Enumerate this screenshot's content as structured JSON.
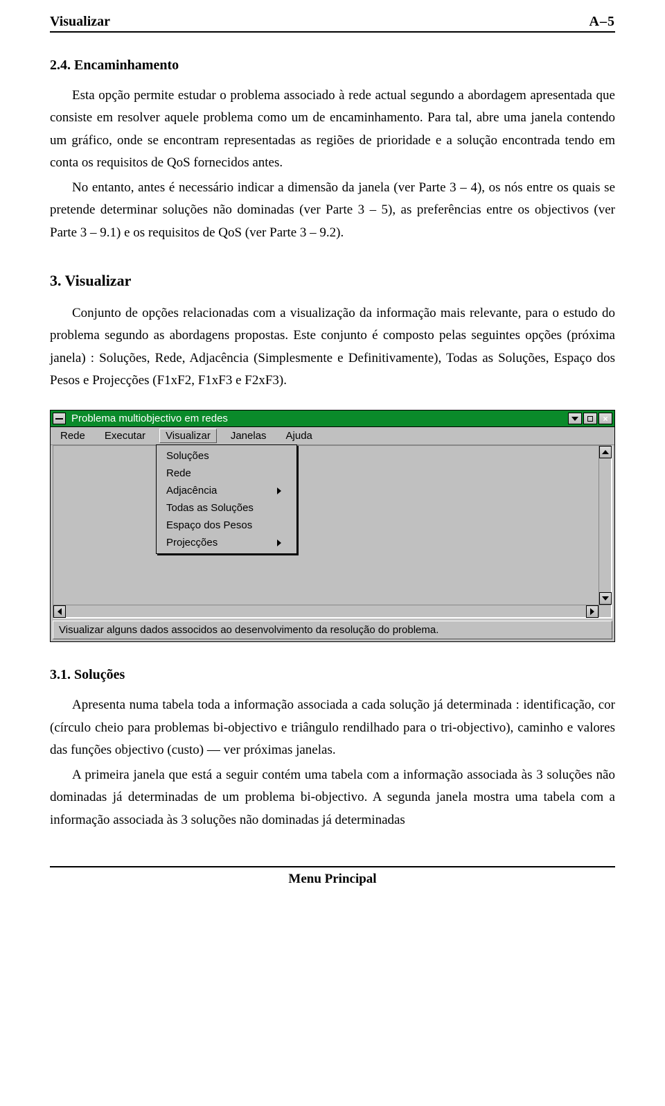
{
  "header": {
    "left": "Visualizar",
    "right": "A–5"
  },
  "sec24": {
    "heading": "2.4. Encaminhamento",
    "p1": "Esta opção permite estudar o problema associado à rede actual segundo a abordagem apresentada que consiste em resolver aquele problema como um de encaminhamento. Para tal, abre uma janela contendo um gráfico, onde se encontram representadas as regiões de prioridade e a solução encontrada tendo em conta os requisitos de QoS fornecidos antes.",
    "p2": "No entanto, antes é necessário indicar a dimensão da janela (ver Parte 3 – 4), os nós entre os quais se pretende determinar soluções não dominadas (ver Parte 3 – 5), as preferências entre os objectivos (ver Parte 3 – 9.1) e os requisitos de QoS (ver Parte 3 – 9.2)."
  },
  "sec3": {
    "heading": "3. Visualizar",
    "p1": "Conjunto de opções relacionadas com a visualização da informação mais relevante, para o estudo do problema segundo as abordagens propostas. Este conjunto é composto pelas seguintes opções (próxima janela) : Soluções, Rede, Adjacência (Simplesmente e Definitivamente), Todas as Soluções, Espaço dos Pesos e Projecções (F1xF2, F1xF3 e F2xF3)."
  },
  "window": {
    "title": "Problema multiobjectivo em redes",
    "menus": [
      "Rede",
      "Executar",
      "Visualizar",
      "Janelas",
      "Ajuda"
    ],
    "selected_menu": "Visualizar",
    "dropdown": [
      {
        "label": "Soluções",
        "submenu": false
      },
      {
        "label": "Rede",
        "submenu": false
      },
      {
        "label": "Adjacência",
        "submenu": true
      },
      {
        "label": "Todas as Soluções",
        "submenu": false
      },
      {
        "label": "Espaço dos Pesos",
        "submenu": false
      },
      {
        "label": "Projecções",
        "submenu": true
      }
    ],
    "status": "Visualizar alguns dados associdos ao desenvolvimento da resolução do problema."
  },
  "sec31": {
    "heading": "3.1. Soluções",
    "p1": "Apresenta numa tabela toda a informação associada a cada solução já determinada : identificação, cor (círculo cheio para problemas bi-objectivo e triângulo rendilhado para o tri-objectivo), caminho e valores das funções objectivo (custo) — ver próximas janelas.",
    "p2": "A primeira janela que está a seguir contém uma tabela com a informação associada às 3 soluções não dominadas já determinadas de um problema bi-objectivo. A segunda janela mostra uma tabela com a informação associada às 3 soluções não dominadas já determinadas"
  },
  "footer": "Menu Principal"
}
